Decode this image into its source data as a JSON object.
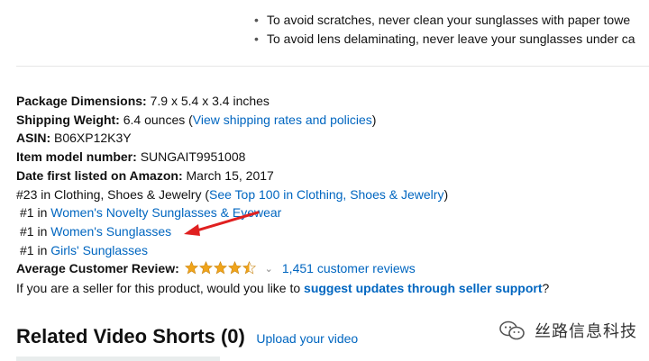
{
  "care_bullets": [
    "To avoid scratches, never clean your sunglasses with paper towe",
    "To avoid lens delaminating, never leave your sunglasses under ca"
  ],
  "details": {
    "package_dimensions": {
      "label": "Package Dimensions:",
      "value": "7.9 x 5.4 x 3.4 inches"
    },
    "shipping_weight": {
      "label": "Shipping Weight:",
      "value": "6.4 ounces (",
      "link": "View shipping rates and policies",
      "suffix": ")"
    },
    "asin": {
      "label": "ASIN:",
      "value": "B06XP12K3Y"
    },
    "model_number": {
      "label": "Item model number:",
      "value": "SUNGAIT9951008"
    },
    "date_first_listed": {
      "label": "Date first listed on Amazon:",
      "value": "March 15, 2017"
    },
    "rank_main": {
      "prefix": "#23 in Clothing, Shoes & Jewelry (",
      "link": "See Top 100 in Clothing, Shoes & Jewelry",
      "suffix": ")"
    },
    "sub_ranks": [
      {
        "rank": "#1 in ",
        "category": "Women's Novelty Sunglasses & Eyewear"
      },
      {
        "rank": "#1 in ",
        "category": "Women's Sunglasses"
      },
      {
        "rank": "#1 in ",
        "category": "Girls' Sunglasses"
      }
    ],
    "average_review": {
      "label": "Average Customer Review:",
      "rating": 4.5,
      "max_rating": 5,
      "reviews_link": "1,451 customer reviews"
    },
    "seller_prompt": {
      "prefix": "If you are a seller for this product, would you like to ",
      "link": "suggest updates through seller support",
      "suffix": "?"
    }
  },
  "related_videos": {
    "title": "Related Video Shorts (0)",
    "upload_link": "Upload your video"
  },
  "watermark": {
    "text": "丝路信息科技"
  },
  "colors": {
    "link": "#0066c0",
    "star": "#f0a41b",
    "arrow": "#e02020"
  }
}
